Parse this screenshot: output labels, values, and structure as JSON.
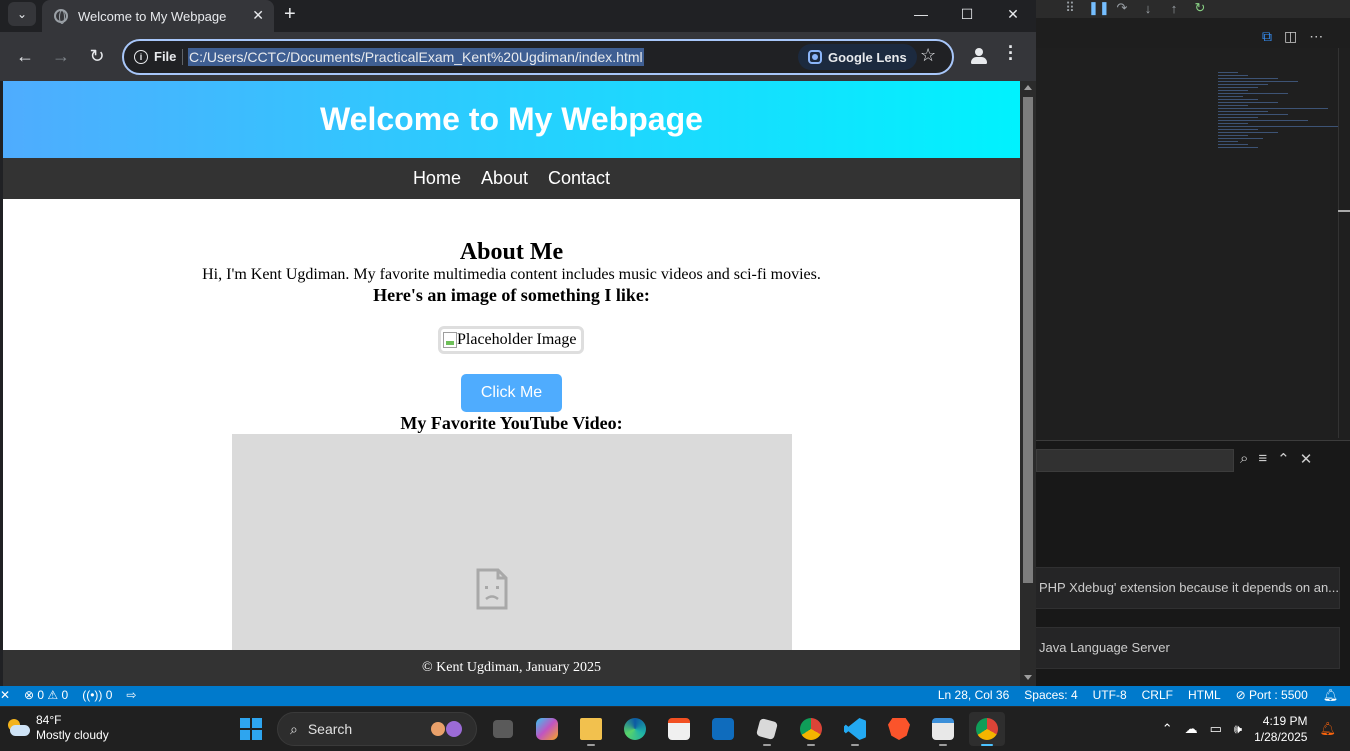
{
  "browser": {
    "tab_title": "Welcome to My Webpage",
    "scheme_label": "File",
    "url": "C:/Users/CCTC/Documents/PracticalExam_Kent%20Ugdiman/index.html",
    "lens_label": "Google Lens"
  },
  "page": {
    "header_title": "Welcome to My Webpage",
    "nav": [
      "Home",
      "About",
      "Contact"
    ],
    "about_title": "About Me",
    "about_text": "Hi, I'm Kent Ugdiman. My favorite multimedia content includes music videos and sci-fi movies.",
    "image_heading": "Here's an image of something I like:",
    "image_alt": "Placeholder Image",
    "button_label": "Click Me",
    "video_heading": "My Favorite YouTube Video:",
    "footer": "© Kent Ugdiman, January 2025",
    "colors": {
      "header_start": "#4facfe",
      "header_end": "#00f2fe",
      "nav_bg": "#333333",
      "button_bg": "#4facfe"
    }
  },
  "vscode": {
    "notifications": [
      "PHP Xdebug' extension because it depends on an...",
      "Java Language Server"
    ],
    "statusbar": {
      "errors": "0",
      "warnings": "0",
      "ports": "0",
      "cursor": "Ln 28, Col 36",
      "spaces": "Spaces: 4",
      "encoding": "UTF-8",
      "eol": "CRLF",
      "language": "HTML",
      "port": "Port : 5500"
    }
  },
  "taskbar": {
    "temperature": "84°F",
    "weather": "Mostly cloudy",
    "search_placeholder": "Search",
    "time": "4:19 PM",
    "date": "1/28/2025"
  }
}
